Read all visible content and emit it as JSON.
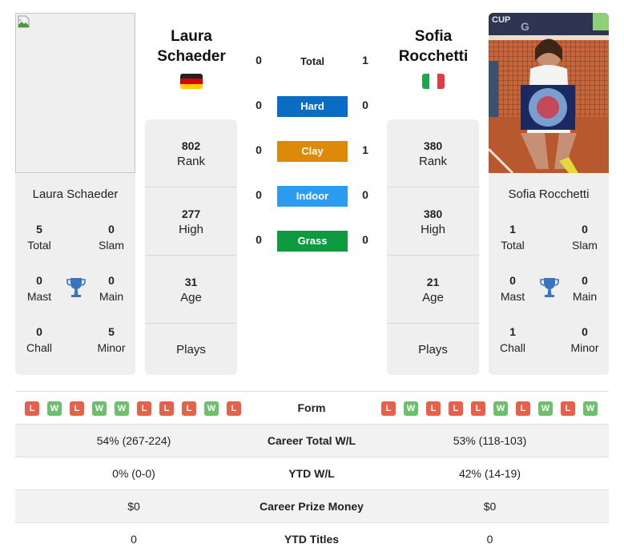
{
  "player1": {
    "name_line1": "Laura",
    "name_line2": "Schaeder",
    "full_name": "Laura Schaeder",
    "country": "Germany",
    "flag_icon": "flag-germany",
    "photo": "broken-image",
    "rank": "802",
    "rank_label": "Rank",
    "high": "277",
    "high_label": "High",
    "age": "31",
    "age_label": "Age",
    "plays_label": "Plays",
    "titles": {
      "total": "5",
      "total_label": "Total",
      "slam": "0",
      "slam_label": "Slam",
      "mast": "0",
      "mast_label": "Mast",
      "main": "0",
      "main_label": "Main",
      "chall": "0",
      "chall_label": "Chall",
      "minor": "5",
      "minor_label": "Minor"
    },
    "form": [
      "L",
      "W",
      "L",
      "W",
      "W",
      "L",
      "L",
      "L",
      "W",
      "L"
    ]
  },
  "player2": {
    "name_line1": "Sofia",
    "name_line2": "Rocchetti",
    "full_name": "Sofia Rocchetti",
    "country": "Italy",
    "flag_icon": "flag-italy",
    "photo": "player-photo-with-trophy",
    "rank": "380",
    "rank_label": "Rank",
    "high": "380",
    "high_label": "High",
    "age": "21",
    "age_label": "Age",
    "plays_label": "Plays",
    "titles": {
      "total": "1",
      "total_label": "Total",
      "slam": "0",
      "slam_label": "Slam",
      "mast": "0",
      "mast_label": "Mast",
      "main": "0",
      "main_label": "Main",
      "chall": "1",
      "chall_label": "Chall",
      "minor": "0",
      "minor_label": "Minor"
    },
    "form": [
      "L",
      "W",
      "L",
      "L",
      "L",
      "W",
      "L",
      "W",
      "L",
      "W"
    ]
  },
  "h2h": {
    "total": {
      "label": "Total",
      "p1": "0",
      "p2": "1"
    },
    "surfaces": [
      {
        "label": "Hard",
        "p1": "0",
        "p2": "0",
        "color": "#0a6cc4"
      },
      {
        "label": "Clay",
        "p1": "0",
        "p2": "1",
        "color": "#dd8a0a"
      },
      {
        "label": "Indoor",
        "p1": "0",
        "p2": "0",
        "color": "#2c9cf0"
      },
      {
        "label": "Grass",
        "p1": "0",
        "p2": "0",
        "color": "#0e9a3e"
      }
    ]
  },
  "comparison": {
    "form_label": "Form",
    "rows": [
      {
        "label": "Career Total W/L",
        "p1": "54% (267-224)",
        "p2": "53% (118-103)"
      },
      {
        "label": "YTD W/L",
        "p1": "0% (0-0)",
        "p2": "42% (14-19)"
      },
      {
        "label": "Career Prize Money",
        "p1": "$0",
        "p2": "$0"
      },
      {
        "label": "YTD Titles",
        "p1": "0",
        "p2": "0"
      }
    ]
  },
  "colors": {
    "loss": "#e9604a",
    "win": "#6cbf6c",
    "trophy": "#3a73c0",
    "card_bg": "#efefef"
  }
}
